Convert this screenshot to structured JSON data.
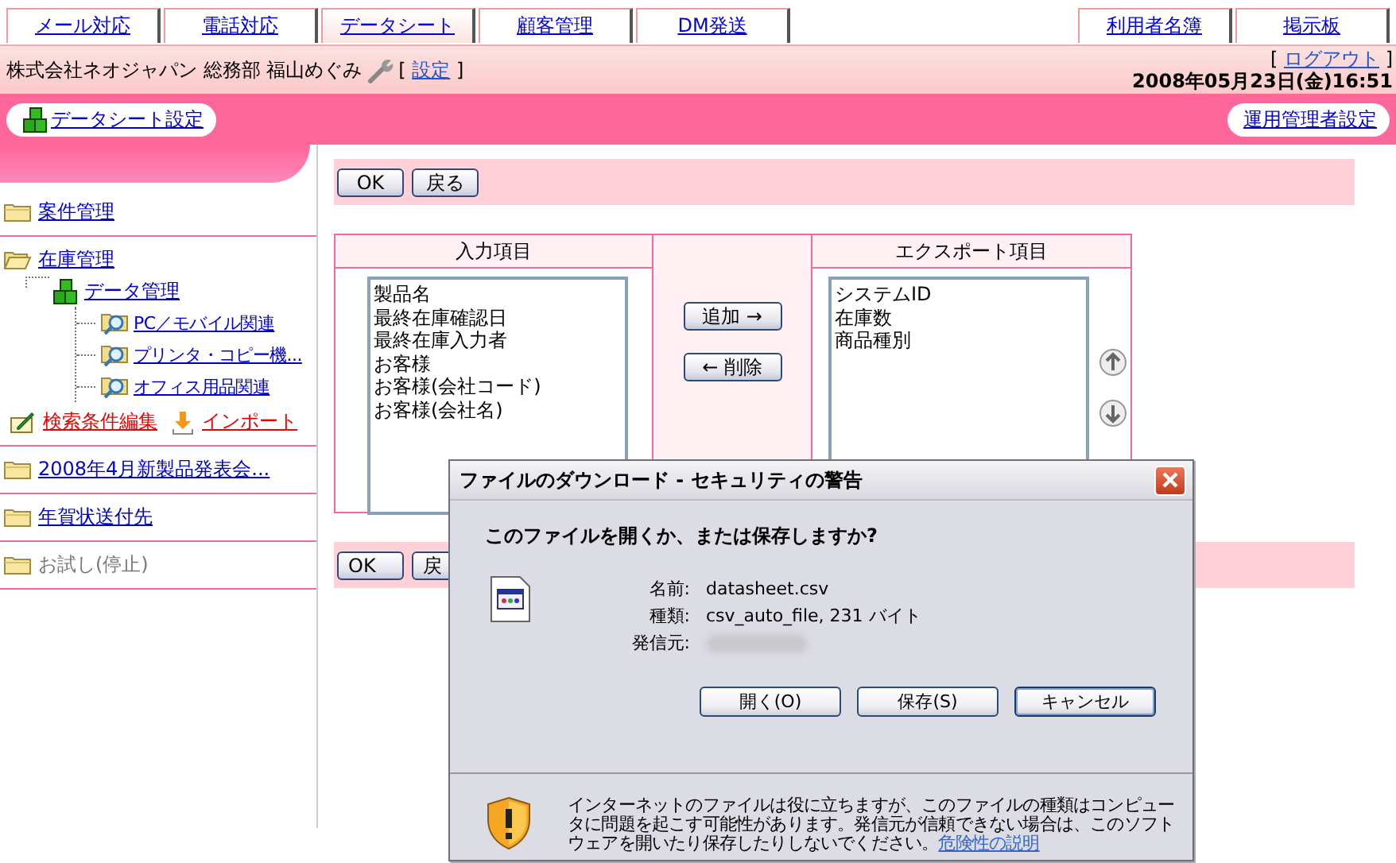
{
  "top_tabs": [
    {
      "label": "メール対応",
      "selected": false
    },
    {
      "label": "電話対応",
      "selected": false
    },
    {
      "label": "データシート",
      "selected": true
    },
    {
      "label": "顧客管理",
      "selected": false
    },
    {
      "label": "DM発送",
      "selected": false
    }
  ],
  "right_tabs": [
    {
      "label": "利用者名簿",
      "selected": false
    },
    {
      "label": "掲示板",
      "selected": false
    }
  ],
  "header": {
    "user": "株式会社ネオジャパン 総務部 福山めぐみ",
    "settings": {
      "open": "[",
      "label": "設定",
      "close": "]"
    },
    "logout": {
      "open": "[",
      "label": "ログアウト",
      "close": "]"
    },
    "datetime": "2008年05月23日(金)16:51"
  },
  "nav_band": {
    "left_button": "データシート設定",
    "right_button": "運用管理者設定"
  },
  "sidebar": {
    "items": [
      {
        "label": "案件管理",
        "expanded": false,
        "disabled": false
      },
      {
        "label": "在庫管理",
        "expanded": true,
        "disabled": false,
        "children": [
          {
            "label": "データ管理",
            "children": [
              {
                "label": "PC／モバイル関連"
              },
              {
                "label": "プリンタ・コピー機..."
              },
              {
                "label": "オフィス用品関連"
              }
            ]
          }
        ],
        "actions": [
          {
            "label": "検索条件編集",
            "kind": "edit"
          },
          {
            "label": "インポート",
            "kind": "import"
          }
        ]
      },
      {
        "label": "2008年4月新製品発表会...",
        "expanded": false,
        "disabled": false
      },
      {
        "label": "年賀状送付先",
        "expanded": false,
        "disabled": false
      },
      {
        "label": "お試し(停止)",
        "expanded": false,
        "disabled": true
      }
    ]
  },
  "toolbar_top": [
    "OK",
    "戻る"
  ],
  "export_table": {
    "input_header": "入力項目",
    "export_header": "エクスポート項目",
    "input_items": [
      "製品名",
      "最終在庫確認日",
      "最終在庫入力者",
      "お客様",
      "お客様(会社コード)",
      "お客様(会社名)"
    ],
    "export_items": [
      "システムID",
      "在庫数",
      "商品種別"
    ],
    "add_button": "追加 →",
    "remove_button": "← 削除"
  },
  "toolbar_bottom": [
    "OK",
    "戻"
  ],
  "dialog": {
    "title": "ファイルのダウンロード - セキュリティの警告",
    "question": "このファイルを開くか、または保存しますか?",
    "fields": [
      {
        "label": "名前:",
        "value": "datasheet.csv",
        "blurred": false
      },
      {
        "label": "種類:",
        "value": "csv_auto_file, 231 バイト",
        "blurred": false
      },
      {
        "label": "発信元:",
        "blurred": true
      }
    ],
    "buttons": [
      {
        "label": "開く(O)",
        "selected": false
      },
      {
        "label": "保存(S)",
        "selected": false
      },
      {
        "label": "キャンセル",
        "selected": true
      }
    ],
    "warning": "インターネットのファイルは役に立ちますが、このファイルの種類はコンピュータに問題を起こす可能性があります。発信元が信頼できない場合は、このソフトウェアを開いたり保存したりしないでください。",
    "warning_link": "危険性の説明"
  }
}
